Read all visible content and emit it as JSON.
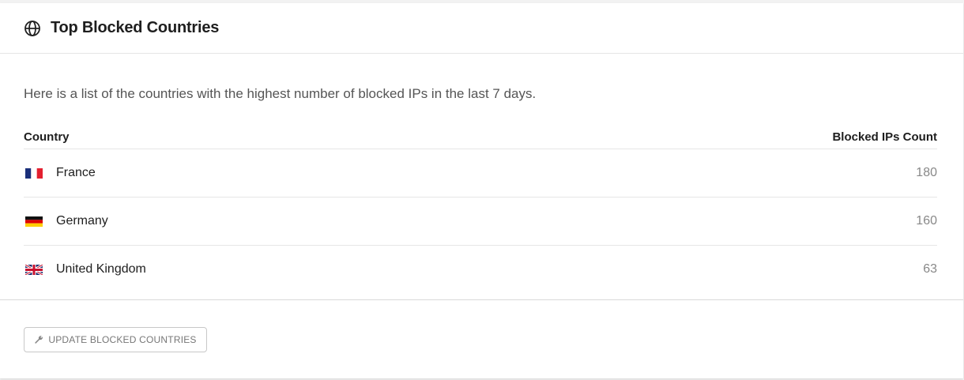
{
  "header": {
    "icon": "globe-icon",
    "title": "Top Blocked Countries"
  },
  "description": "Here is a list of the countries with the highest number of blocked IPs in the last 7 days.",
  "table": {
    "columns": [
      "Country",
      "Blocked IPs Count"
    ],
    "rows": [
      {
        "flag": "france-flag-icon",
        "country": "France",
        "count": "180"
      },
      {
        "flag": "germany-flag-icon",
        "country": "Germany",
        "count": "160"
      },
      {
        "flag": "uk-flag-icon",
        "country": "United Kingdom",
        "count": "63"
      }
    ]
  },
  "footer": {
    "button_icon": "wrench-icon",
    "button_label": "UPDATE BLOCKED COUNTRIES"
  },
  "colors": {
    "title": "#1e1e1e",
    "muted_text": "#888888",
    "border": "#e6e6e6"
  }
}
